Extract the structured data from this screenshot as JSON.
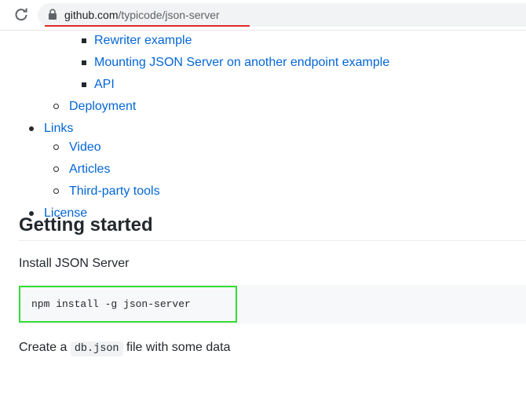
{
  "browser": {
    "url_host": "github.com",
    "url_path": "/typicode/json-server"
  },
  "toc": {
    "rewriter": "Rewriter example",
    "mounting": "Mounting JSON Server on another endpoint example",
    "api": "API",
    "deployment": "Deployment",
    "links": "Links",
    "video": "Video",
    "articles": "Articles",
    "third_party": "Third-party tools",
    "license": "License"
  },
  "section": {
    "heading": "Getting started",
    "install_text": "Install JSON Server",
    "install_command": "npm install -g json-server",
    "create_prefix": "Create a",
    "create_code": "db.json",
    "create_suffix": "file with some data"
  },
  "colors": {
    "link": "#0366d6",
    "highlight": "#33dd33",
    "url_underline": "#e02b2b"
  }
}
